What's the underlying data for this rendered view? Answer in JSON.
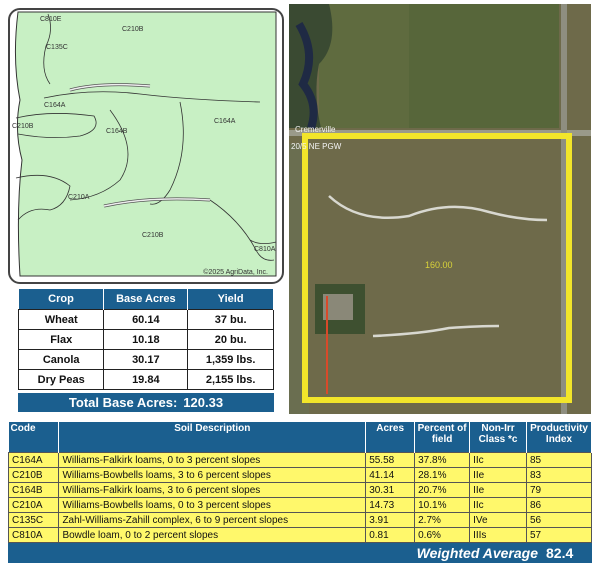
{
  "soil_map": {
    "labels": [
      "C810E",
      "C210B",
      "C135C",
      "C164A",
      "C210B",
      "C164B",
      "C164A",
      "C210A",
      "C210B",
      "C810A"
    ],
    "copyright": "©2025 AgriData, Inc."
  },
  "aerial": {
    "road_label": "Cremerville",
    "road_label_2": "20/5 NE PGW",
    "field_acres": "160.00",
    "field_color": "#f2e52a"
  },
  "crop_table": {
    "headers": [
      "Crop",
      "Base Acres",
      "Yield"
    ],
    "rows": [
      {
        "crop": "Wheat",
        "acres": "60.14",
        "yield": "37 bu."
      },
      {
        "crop": "Flax",
        "acres": "10.18",
        "yield": "20 bu."
      },
      {
        "crop": "Canola",
        "acres": "30.17",
        "yield": "1,359 lbs."
      },
      {
        "crop": "Dry Peas",
        "acres": "19.84",
        "yield": "2,155 lbs."
      }
    ],
    "total_label": "Total Base Acres:",
    "total_value": "120.33"
  },
  "soil_table": {
    "headers": {
      "code": "Code",
      "description": "Soil Description",
      "acres": "Acres",
      "percent": "Percent of field",
      "class": "Non-Irr Class *c",
      "index": "Productivity Index"
    },
    "rows": [
      {
        "code": "C164A",
        "description": "Williams-Falkirk loams, 0 to 3 percent slopes",
        "acres": "55.58",
        "percent": "37.8%",
        "class": "IIc",
        "index": "85"
      },
      {
        "code": "C210B",
        "description": "Williams-Bowbells loams, 3 to 6 percent slopes",
        "acres": "41.14",
        "percent": "28.1%",
        "class": "IIe",
        "index": "83"
      },
      {
        "code": "C164B",
        "description": "Williams-Falkirk loams, 3 to 6 percent slopes",
        "acres": "30.31",
        "percent": "20.7%",
        "class": "IIe",
        "index": "79"
      },
      {
        "code": "C210A",
        "description": "Williams-Bowbells loams, 0 to 3 percent slopes",
        "acres": "14.73",
        "percent": "10.1%",
        "class": "IIc",
        "index": "86"
      },
      {
        "code": "C135C",
        "description": "Zahl-Williams-Zahill complex, 6 to 9 percent slopes",
        "acres": "3.91",
        "percent": "2.7%",
        "class": "IVe",
        "index": "56"
      },
      {
        "code": "C810A",
        "description": "Bowdle loam, 0 to 2 percent slopes",
        "acres": "0.81",
        "percent": "0.6%",
        "class": "IIIs",
        "index": "57"
      }
    ],
    "weighted_label": "Weighted Average",
    "weighted_value": "82.4"
  },
  "colors": {
    "header_blue": "#1b5f8f",
    "soil_green": "#c8f0c4",
    "row_yellow": "#fff86b"
  }
}
